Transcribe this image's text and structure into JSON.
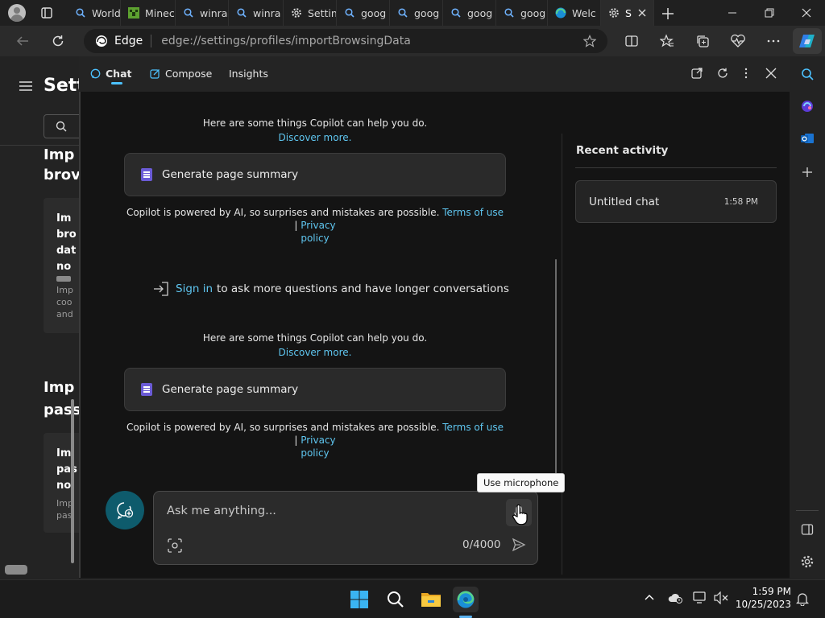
{
  "tabs": [
    {
      "label": "World",
      "icon": "search-icon"
    },
    {
      "label": "Minec",
      "icon": "minecraft-icon"
    },
    {
      "label": "winra",
      "icon": "search-icon"
    },
    {
      "label": "winra",
      "icon": "search-icon"
    },
    {
      "label": "Settin",
      "icon": "gear-icon"
    },
    {
      "label": "goog",
      "icon": "search-icon"
    },
    {
      "label": "goog",
      "icon": "search-icon"
    },
    {
      "label": "goog",
      "icon": "search-icon"
    },
    {
      "label": "goog",
      "icon": "search-icon"
    },
    {
      "label": "Welc",
      "icon": "edge-icon"
    },
    {
      "label": "S",
      "icon": "gear-icon"
    }
  ],
  "address": {
    "brand": "Edge",
    "url": "edge://settings/profiles/importBrowsingData"
  },
  "settings_page": {
    "title": "Sett",
    "section1": [
      "Imp",
      "brov"
    ],
    "card1_lines": [
      "Im",
      "bro",
      "dat",
      "no"
    ],
    "card1_sub": [
      "Imp",
      "coo",
      "and"
    ],
    "section2": [
      "Imp",
      "pass"
    ],
    "card2_lines": [
      "Im",
      "pas",
      "no"
    ],
    "card2_sub": [
      "Imp",
      "pas"
    ]
  },
  "copilot": {
    "tabs": {
      "chat": "Chat",
      "compose": "Compose",
      "insights": "Insights"
    },
    "help_text": "Here are some things Copilot can help you do.",
    "discover": "Discover more.",
    "suggestion": "Generate page summary",
    "disclaimer_prefix": "Copilot is powered by AI, so surprises and mistakes are possible.",
    "terms": "Terms of use",
    "pipe": "|",
    "privacy": "Privacy",
    "policy": "policy",
    "signin_link": "Sign in",
    "signin_rest": "to ask more questions and have longer conversations",
    "input_placeholder": "Ask me anything...",
    "counter": "0/4000",
    "tooltip": "Use microphone",
    "recent_title": "Recent activity",
    "recent_item": {
      "title": "Untitled chat",
      "time": "1:58 PM"
    }
  },
  "clock": {
    "time": "1:59 PM",
    "date": "10/25/2023"
  },
  "colors": {
    "accent": "#4cc2ff",
    "link": "#5fc6f0",
    "panel_bg": "#141414",
    "new_topic": "#0e5b6c"
  }
}
